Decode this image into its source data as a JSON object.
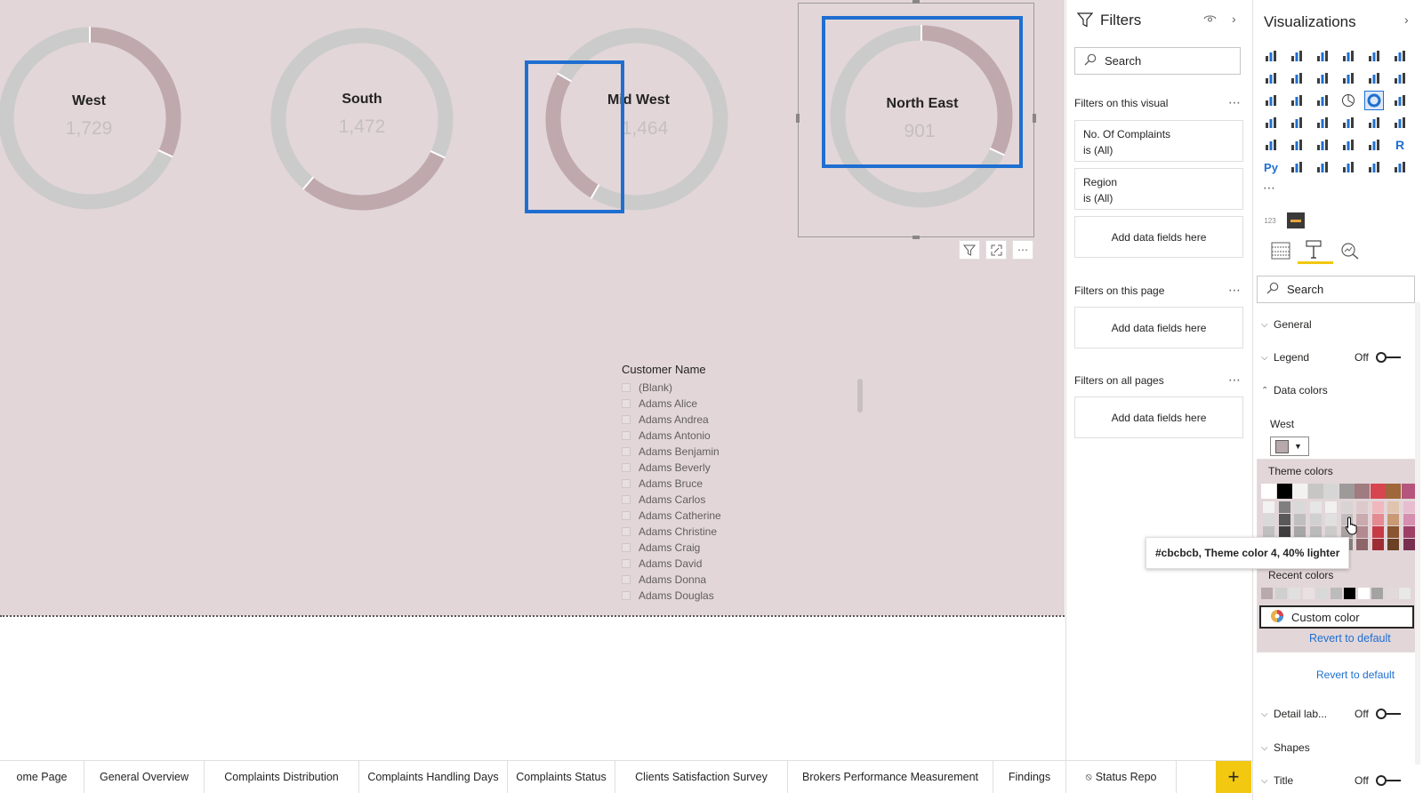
{
  "canvas": {
    "donuts": [
      {
        "region": "West",
        "value": "1,729"
      },
      {
        "region": "South",
        "value": "1,472"
      },
      {
        "region": "Mid West",
        "value": "1,464"
      },
      {
        "region": "North East",
        "value": "901"
      }
    ],
    "colors": {
      "background": "#e2d6d9",
      "ring": "#cbcbcb",
      "arc": "#c0a9ad",
      "selection": "#1f6fd1"
    },
    "slicer": {
      "title": "Customer Name",
      "items": [
        "(Blank)",
        "Adams Alice",
        "Adams Andrea",
        "Adams Antonio",
        "Adams Benjamin",
        "Adams Beverly",
        "Adams Bruce",
        "Adams Carlos",
        "Adams Catherine",
        "Adams Christine",
        "Adams Craig",
        "Adams David",
        "Adams Donna",
        "Adams Douglas"
      ]
    }
  },
  "filters": {
    "title": "Filters",
    "search_placeholder": "Search",
    "on_visual_label": "Filters on this visual",
    "visual_filters": [
      {
        "field": "No. Of Complaints",
        "state": "is (All)"
      },
      {
        "field": "Region",
        "state": "is (All)"
      }
    ],
    "add_fields_label": "Add data fields here",
    "on_page_label": "Filters on this page",
    "on_all_pages_label": "Filters on all pages"
  },
  "visualizations": {
    "title": "Visualizations",
    "search_placeholder": "Search",
    "format": {
      "general": "General",
      "legend": "Legend",
      "legend_state": "Off",
      "data_colors": "Data colors",
      "west_label": "West",
      "theme_colors": "Theme colors",
      "recent_colors": "Recent colors",
      "custom_color": "Custom color",
      "revert_inner": "Revert to default",
      "revert_outer": "Revert to default",
      "detail_labels": "Detail lab...",
      "detail_state": "Off",
      "shapes": "Shapes",
      "title_row": "Title",
      "title_state": "Off"
    },
    "tooltip": "#cbcbcb, Theme color 4, 40% lighter",
    "theme_colors": [
      "#ffffff",
      "#000000",
      "#f3f2f1",
      "#c8c6c4",
      "#d6d6d6",
      "#9e9a9a",
      "#a07b7f",
      "#d64550",
      "#a0673a",
      "#b5557e"
    ],
    "theme_shades": [
      [
        "#f2f2f2",
        "#7f7f7f",
        "#d9d9d9",
        "#e6e6e6",
        "#f0f0f0",
        "#d8d4d4",
        "#ddc9cb",
        "#f0b8bc",
        "#e0c4ae",
        "#e8bdd0"
      ],
      [
        "#d9d9d9",
        "#595959",
        "#bfbfbf",
        "#d0d0d0",
        "#e0e0e0",
        "#c2bdbd",
        "#c9aaae",
        "#e58a91",
        "#c99a74",
        "#d58fb0"
      ],
      [
        "#bfbfbf",
        "#3f3f3f",
        "#a6a6a6",
        "#bbbbbb",
        "#cbcbcb",
        "#a8a2a2",
        "#b38a8f",
        "#c73b46",
        "#8a5530",
        "#9e3f68"
      ],
      [
        "#a6a6a6",
        "#262626",
        "#8c8c8c",
        "#a0a0a0",
        "#b0b0b0",
        "#8c8585",
        "#8d6569",
        "#9e2c35",
        "#6a4124",
        "#782f4f"
      ]
    ],
    "recent_colors": [
      "#b8a9ac",
      "#cfcfcf",
      "#e0e0e0",
      "#e9e0e2",
      "#d8d8d8",
      "#bcbcbc",
      "#000000",
      "#ffffff",
      "#a3a3a3",
      "#e0dada",
      "#e8e8e8"
    ]
  },
  "tabs": [
    "ome Page",
    "General Overview",
    "Complaints Distribution",
    "Complaints Handling Days",
    "Complaints Status",
    "Clients Satisfaction Survey",
    "Brokers Performance Measurement",
    "Findings",
    "Status Repo"
  ],
  "add_page_icon": "plus-icon"
}
